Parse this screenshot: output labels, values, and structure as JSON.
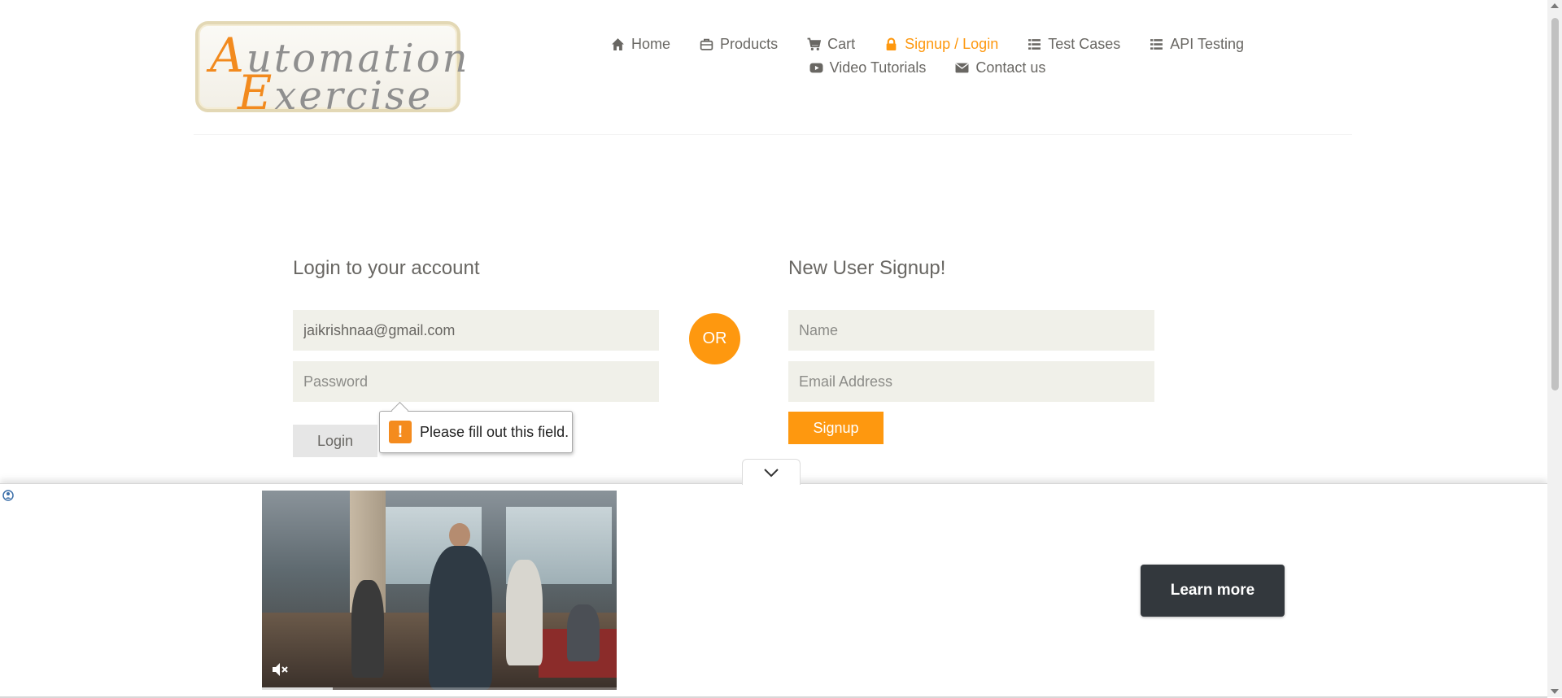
{
  "brand": {
    "logo_line1_cap": "A",
    "logo_line1_rest": "utomation",
    "logo_line2_cap": "E",
    "logo_line2_rest": "xercise"
  },
  "nav": {
    "items": [
      {
        "label": "Home",
        "icon": "home-icon"
      },
      {
        "label": "Products",
        "icon": "briefcase-icon"
      },
      {
        "label": "Cart",
        "icon": "cart-icon"
      },
      {
        "label": "Signup / Login",
        "icon": "lock-icon",
        "active": true
      },
      {
        "label": "Test Cases",
        "icon": "list-icon"
      },
      {
        "label": "API Testing",
        "icon": "list-icon"
      },
      {
        "label": "Video Tutorials",
        "icon": "youtube-icon"
      },
      {
        "label": "Contact us",
        "icon": "envelope-icon"
      }
    ]
  },
  "login": {
    "title": "Login to your account",
    "email_value": "jaikrishnaa@gmail.com",
    "password_placeholder": "Password",
    "button": "Login"
  },
  "or_label": "OR",
  "signup": {
    "title": "New User Signup!",
    "name_placeholder": "Name",
    "email_placeholder": "Email Address",
    "button": "Signup"
  },
  "tooltip": {
    "icon": "!",
    "message": "Please fill out this field."
  },
  "ad": {
    "cta": "Learn more"
  },
  "colors": {
    "accent": "#fe980f",
    "text": "#696763",
    "field_bg": "#f0f0e9"
  }
}
